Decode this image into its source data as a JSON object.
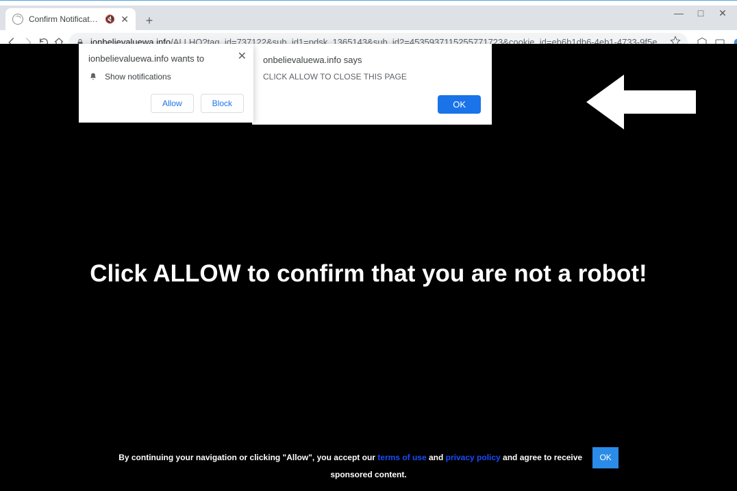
{
  "window": {
    "minimize": "—",
    "maximize": "□",
    "close": "✕"
  },
  "tab": {
    "title": "Confirm Notifications",
    "audio_glyph": "🔇",
    "close_glyph": "✕"
  },
  "newtab_glyph": "+",
  "toolbar": {
    "url_domain": "ionbelievaluewa.info",
    "url_path": "/ALLHQ?tag_id=737122&sub_id1=pdsk_1365143&sub_id2=4535937115255771723&cookie_id=eb6b1db6-4eb1-4733-9f5e..."
  },
  "perm": {
    "prompt": "ionbelievaluewa.info wants to",
    "item": "Show notifications",
    "allow": "Allow",
    "block": "Block",
    "close_glyph": "✕"
  },
  "alert": {
    "origin": "onbelievaluewa.info says",
    "message": "CLICK ALLOW TO CLOSE THIS PAGE",
    "ok": "OK"
  },
  "headline": "Click ALLOW to confirm that you are not a robot!",
  "footer": {
    "part1": "By continuing your navigation or clicking \"Allow\", you accept our ",
    "terms": "terms of use",
    "and": " and ",
    "privacy": "privacy policy",
    "part2": " and agree to receive",
    "part3": "sponsored content.",
    "ok": "OK"
  }
}
